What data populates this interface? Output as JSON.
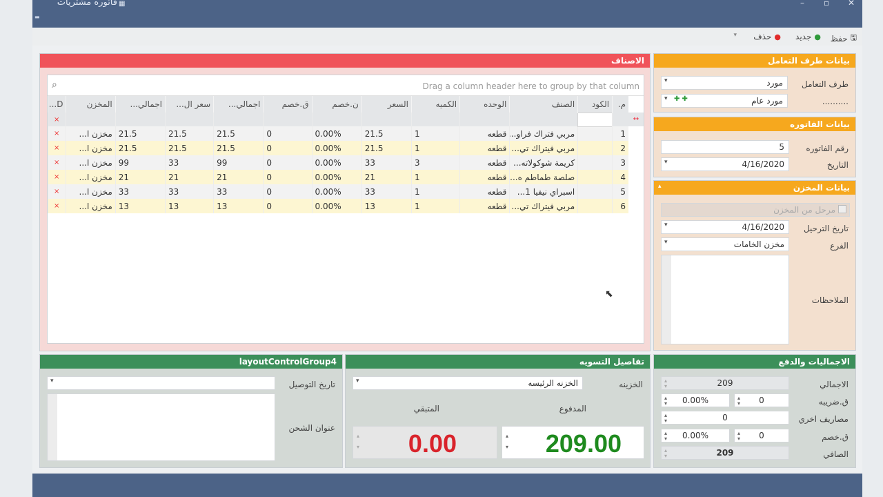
{
  "window": {
    "title": "فاتوره مشتريات",
    "controls": [
      "–",
      "▫",
      "✕"
    ]
  },
  "toolbar": {
    "save": "حفظ",
    "new": "جديد",
    "delete": "حذف"
  },
  "party": {
    "header": "بيانات طرف التعامل",
    "type_label": "طرف التعامل",
    "type_value": "مورد",
    "name_label": "..........",
    "name_value": "مورد عام"
  },
  "invoice": {
    "header": "بيانات الفاتوره",
    "number_label": "رقم الفاتوره",
    "number_value": "5",
    "date_label": "التاريخ",
    "date_value": "4/16/2020"
  },
  "store": {
    "header": "بيانات المخزن",
    "posted_label": "مرحل من المخزن",
    "post_date_label": "تاريخ الترحيل",
    "post_date_value": "4/16/2020",
    "branch_label": "الفرع",
    "branch_value": "مخزن الخامات",
    "notes_label": "الملاحظات"
  },
  "items": {
    "header": "الاصناف",
    "group_hint": "Drag a column header here to group by that column",
    "columns": [
      "م.",
      "الكود",
      "الصنف",
      "الوحده",
      "الكميه",
      "السعر",
      "ن.خصم",
      "ق.خصم",
      "اجمالي...",
      "سعر ال...",
      "اجمالي...",
      "المخزن",
      "D..."
    ],
    "rows": [
      [
        "1",
        "",
        "مربي فتراك فراو...",
        "قطعه",
        "1",
        "21.5",
        "0.00%",
        "0",
        "21.5",
        "21.5",
        "21.5",
        "مخزن ا...",
        "×"
      ],
      [
        "2",
        "",
        "مربي فيتراك تي...",
        "قطعه",
        "1",
        "21.5",
        "0.00%",
        "0",
        "21.5",
        "21.5",
        "21.5",
        "مخزن ا...",
        "×"
      ],
      [
        "3",
        "",
        "كريمة شوكولاته...",
        "قطعه",
        "3",
        "33",
        "0.00%",
        "0",
        "99",
        "33",
        "99",
        "مخزن ا...",
        "×"
      ],
      [
        "4",
        "",
        "صلصة طماطم ه...",
        "قطعه",
        "1",
        "21",
        "0.00%",
        "0",
        "21",
        "21",
        "21",
        "مخزن ا...",
        "×"
      ],
      [
        "5",
        "",
        "اسبراي نيفيا 1...",
        "قطعه",
        "1",
        "33",
        "0.00%",
        "0",
        "33",
        "33",
        "33",
        "مخزن ا...",
        "×"
      ],
      [
        "6",
        "",
        "مربي فيتراك تي...",
        "قطعه",
        "1",
        "13",
        "0.00%",
        "0",
        "13",
        "13",
        "13",
        "مخزن ا...",
        "×"
      ]
    ]
  },
  "totals": {
    "header": "الاجماليات والدفع",
    "total_label": "الاجمالي",
    "total_value": "209",
    "tax_label": "ق.ضريبه",
    "tax_value": "0",
    "tax_pct": "0.00%",
    "other_label": "مصاريف اخري",
    "other_value": "0",
    "discount_label": "ق.خصم",
    "discount_value": "0",
    "discount_pct": "0.00%",
    "net_label": "الصافي",
    "net_value": "209"
  },
  "settlement": {
    "header": "تفاصيل التسويه",
    "treasury_label": "الخزينه",
    "treasury_value": "الخزنه الرئيسه",
    "paid_label": "المدفوع",
    "paid_value": "209.00",
    "remaining_label": "المتبقي",
    "remaining_value": "0.00",
    "paid_color": "#1e8a1e",
    "remaining_color": "#d9232b"
  },
  "shipping": {
    "header": "layoutControlGroup4",
    "delivery_date_label": "تاريخ التوصيل",
    "address_label": "عنوان الشحن"
  }
}
